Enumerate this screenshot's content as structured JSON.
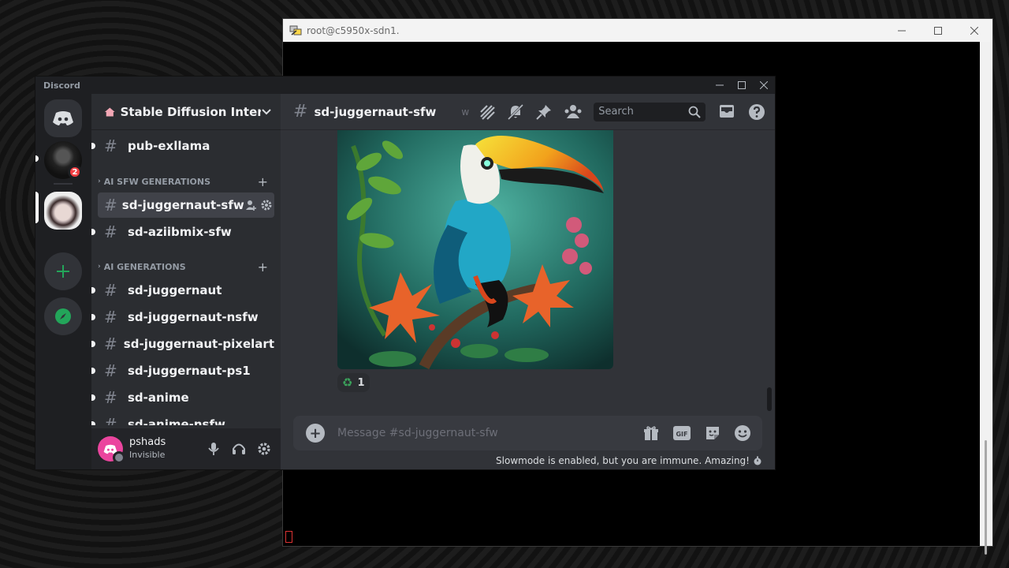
{
  "terminal": {
    "title": "root@c5950x-sdn1."
  },
  "discord": {
    "window_title": "Discord",
    "server_badge": "2",
    "guild_name": "Stable Diffusion Inter...",
    "channels_top": [
      {
        "name": "pub-exllama"
      }
    ],
    "category_sfw": "AI SFW GENERATIONS",
    "sfw_channels": [
      {
        "name": "sd-juggernaut-sfw",
        "active": true
      },
      {
        "name": "sd-aziibmix-sfw"
      }
    ],
    "category_gen": "AI GENERATIONS",
    "gen_channels": [
      {
        "name": "sd-juggernaut"
      },
      {
        "name": "sd-juggernaut-nsfw"
      },
      {
        "name": "sd-juggernaut-pixelart"
      },
      {
        "name": "sd-juggernaut-ps1"
      },
      {
        "name": "sd-anime"
      },
      {
        "name": "sd-anime-nsfw"
      }
    ],
    "user": {
      "name": "pshads",
      "status": "Invisible"
    },
    "channel_title": "sd-juggernaut-sfw",
    "topic_initial": "w",
    "search_placeholder": "Search",
    "reaction": {
      "emoji": "♻",
      "count": "1"
    },
    "composer_placeholder": "Message #sd-juggernaut-sfw",
    "slowmode_text": "Slowmode is enabled, but you are immune. Amazing!",
    "colors": {
      "accent": "#5865f2",
      "green": "#23a55a",
      "red_badge": "#f23f43"
    }
  }
}
